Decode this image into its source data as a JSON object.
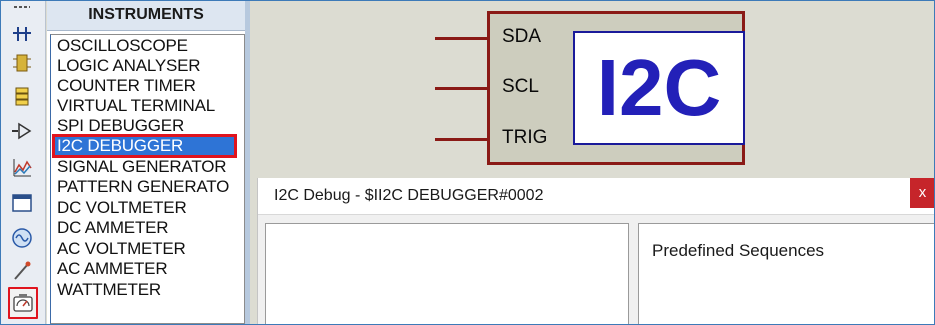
{
  "instruments_panel": {
    "title": "INSTRUMENTS",
    "items": [
      "OSCILLOSCOPE",
      "LOGIC ANALYSER",
      "COUNTER TIMER",
      "VIRTUAL TERMINAL",
      "SPI DEBUGGER",
      "I2C DEBUGGER",
      "SIGNAL GENERATOR",
      "PATTERN GENERATO",
      "DC VOLTMETER",
      "DC AMMETER",
      "AC VOLTMETER",
      "AC AMMETER",
      "WATTMETER"
    ],
    "selected_index": 5
  },
  "toolbar": {
    "icons": [
      "dots-icon",
      "junction-icon",
      "component-icon",
      "terminal-icon",
      "port-icon",
      "graph-icon",
      "tape-icon",
      "generator-icon",
      "probe-icon",
      "instruments-icon"
    ],
    "selected": "instruments-icon"
  },
  "component": {
    "pins": [
      "SDA",
      "SCL",
      "TRIG"
    ],
    "logo": "I2C"
  },
  "debug_window": {
    "title": "I2C Debug - $II2C DEBUGGER#0002",
    "close": "x",
    "predefined_heading": "Predefined Sequences"
  },
  "colors": {
    "selection": "#2e74d6",
    "highlight_outline": "#e0141e",
    "component_outline": "#8a1a16",
    "logo_text": "#2320b8",
    "close_button": "#c6252a"
  }
}
